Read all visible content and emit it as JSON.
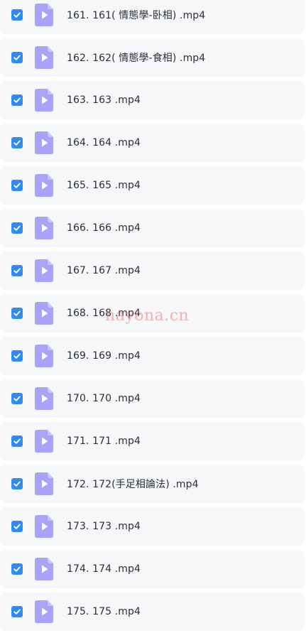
{
  "files": [
    {
      "name": "161. 161( 情態學-卧相) .mp4",
      "checked": true
    },
    {
      "name": "162. 162( 情態學-食相) .mp4",
      "checked": true
    },
    {
      "name": "163. 163 .mp4",
      "checked": true
    },
    {
      "name": "164. 164 .mp4",
      "checked": true
    },
    {
      "name": "165. 165 .mp4",
      "checked": true
    },
    {
      "name": "166. 166 .mp4",
      "checked": true
    },
    {
      "name": "167. 167 .mp4",
      "checked": true
    },
    {
      "name": "168. 168 .mp4",
      "checked": true
    },
    {
      "name": "169. 169 .mp4",
      "checked": true
    },
    {
      "name": "170. 170 .mp4",
      "checked": true
    },
    {
      "name": "171. 171 .mp4",
      "checked": true
    },
    {
      "name": "172. 172(手足相論法) .mp4",
      "checked": true
    },
    {
      "name": "173. 173 .mp4",
      "checked": true
    },
    {
      "name": "174. 174 .mp4",
      "checked": true
    },
    {
      "name": "175. 175 .mp4",
      "checked": true
    }
  ],
  "icons": {
    "checkbox": "checkbox-checked-icon",
    "file": "video-file-icon"
  },
  "colors": {
    "checkbox": "#2f8cf5",
    "file_icon": "#a9a3f7",
    "file_icon_fold": "#c9c5fb",
    "row_background": "#f6f7f9",
    "text": "#2b2f36"
  },
  "watermark": "nayona.cn"
}
